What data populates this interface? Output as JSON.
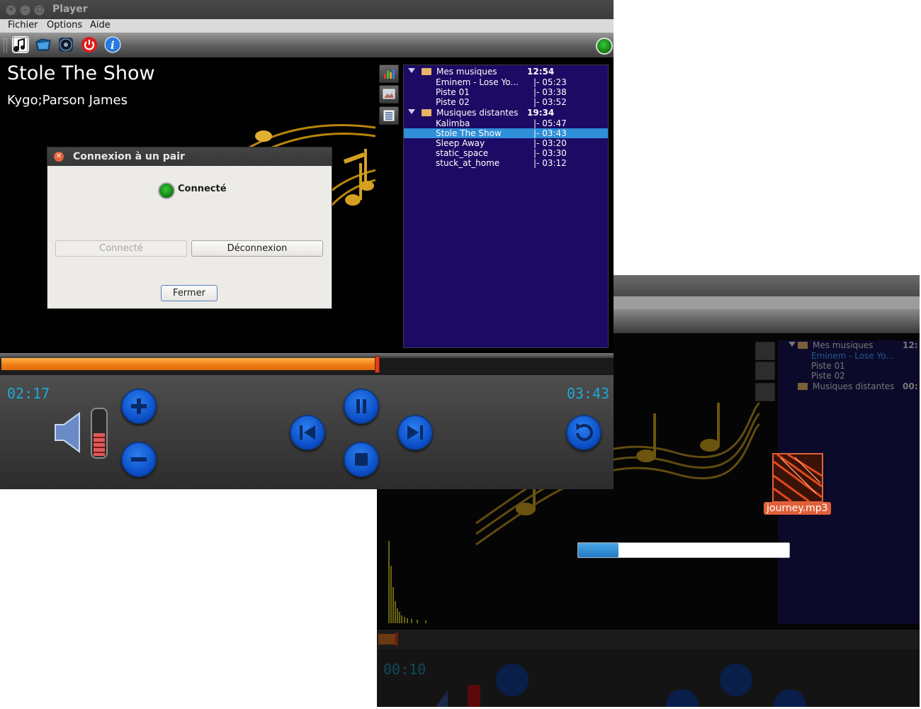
{
  "background_window": {
    "playlist": {
      "folders": [
        {
          "name": "Mes musiques",
          "total": "12:",
          "items": [
            "Eminem - Lose Yo...",
            "Piste 01",
            "Piste 02"
          ]
        },
        {
          "name": "Musiques distantes",
          "total": "00:"
        }
      ]
    },
    "elapsed": "00:10"
  },
  "window": {
    "title": "Player",
    "menu": [
      "Fichier",
      "Options",
      "Aide"
    ],
    "toolbar_icons": [
      "music-note-icon",
      "open-folder-icon",
      "speaker-disc-icon",
      "power-icon",
      "info-icon"
    ],
    "connection_led": "connected"
  },
  "now_playing": {
    "title": "Stole The Show",
    "artist": "Kygo;Parson James"
  },
  "playlist": {
    "folders": [
      {
        "name": "Mes musiques",
        "total": "12:54",
        "items": [
          {
            "name": "Eminem - Lose Yo...",
            "duration": "|- 05:23"
          },
          {
            "name": "Piste 01",
            "duration": "|- 03:38"
          },
          {
            "name": "Piste 02",
            "duration": "|- 03:52"
          }
        ]
      },
      {
        "name": "Musiques distantes",
        "total": "19:34",
        "items": [
          {
            "name": "Kalimba",
            "duration": "|- 05:47"
          },
          {
            "name": "Stole The Show",
            "duration": "|- 03:43",
            "selected": true
          },
          {
            "name": "Sleep Away",
            "duration": "|- 03:20"
          },
          {
            "name": "static_space",
            "duration": "|- 03:30"
          },
          {
            "name": "stuck_at_home",
            "duration": "|- 03:12"
          }
        ]
      }
    ]
  },
  "playback": {
    "elapsed": "02:17",
    "total": "03:43",
    "progress_fraction": 0.614,
    "volume_fraction": 0.5
  },
  "dialog": {
    "title": "Connexion à un pair",
    "status": "Connecté",
    "connect_button": "Connecté",
    "disconnect_button": "Déconnexion",
    "close_button": "Fermer"
  },
  "desktop": {
    "file_icon_label": "journey.mp3",
    "transfer_progress_fraction": 0.19
  },
  "colors": {
    "accent_blue": "#2f8fd8",
    "playlist_bg": "#1c0a64",
    "time_text": "#21a7d8",
    "seek_fill": "#f07a10"
  }
}
